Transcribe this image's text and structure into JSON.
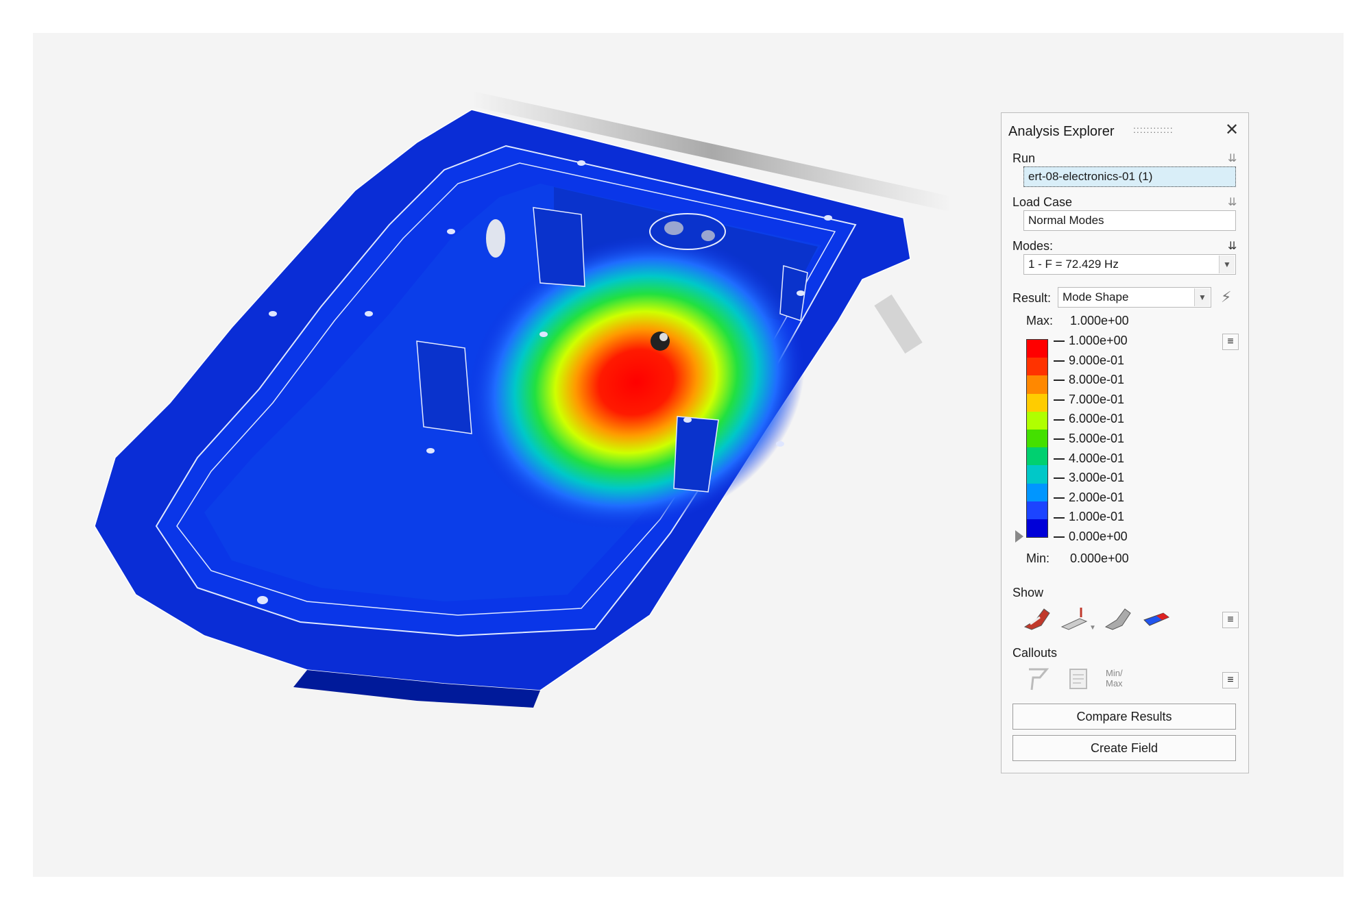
{
  "panel": {
    "title": "Analysis Explorer",
    "grip": "::::::::::::",
    "close_glyph": "✕",
    "run": {
      "label": "Run",
      "value": "ert-08-electronics-01 (1)"
    },
    "load_case": {
      "label": "Load Case",
      "value": "Normal Modes"
    },
    "modes": {
      "label": "Modes:",
      "value": "1 - F = 72.429 Hz"
    },
    "result": {
      "label": "Result:",
      "value": "Mode Shape"
    },
    "legend": {
      "max_label": "Max:",
      "max_value": "1.000e+00",
      "min_label": "Min:",
      "min_value": "0.000e+00",
      "ticks": [
        "1.000e+00",
        "9.000e-01",
        "8.000e-01",
        "7.000e-01",
        "6.000e-01",
        "5.000e-01",
        "4.000e-01",
        "3.000e-01",
        "2.000e-01",
        "1.000e-01",
        "0.000e+00"
      ],
      "colors": [
        "#ff0000",
        "#ff3300",
        "#ff8800",
        "#ffcc00",
        "#b0ff00",
        "#44e000",
        "#00d070",
        "#00c8c8",
        "#0096ff",
        "#1c44ff",
        "#0000d8"
      ]
    },
    "show": {
      "label": "Show"
    },
    "callouts": {
      "label": "Callouts",
      "minmax_label": "Min/\nMax"
    },
    "compare_button": "Compare Results",
    "create_field_button": "Create Field"
  }
}
